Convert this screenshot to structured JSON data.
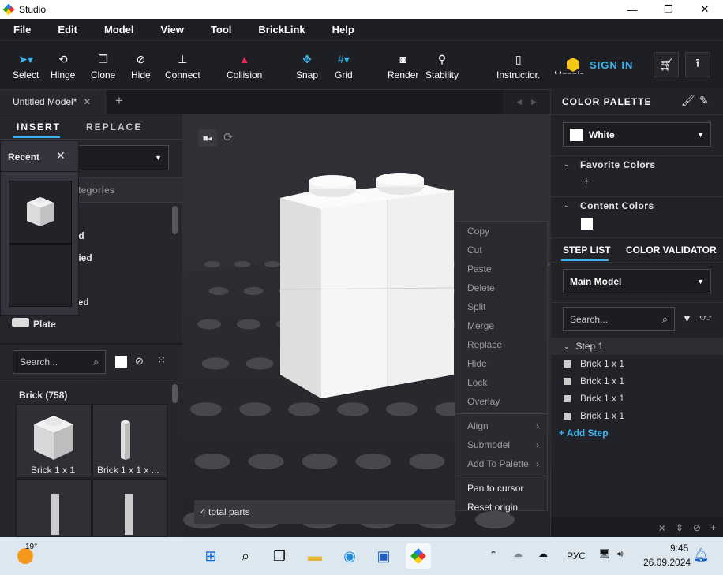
{
  "window": {
    "title": "Studio",
    "minimize": "—",
    "maximize": "❐",
    "close": "✕"
  },
  "menu": [
    "File",
    "Edit",
    "Model",
    "View",
    "Tool",
    "BrickLink",
    "Help"
  ],
  "toolbar": {
    "tools": [
      {
        "label": "Select",
        "icon": "cursor-icon"
      },
      {
        "label": "Hinge",
        "icon": "hinge-icon"
      },
      {
        "label": "Clone",
        "icon": "clone-icon"
      },
      {
        "label": "Hide",
        "icon": "hide-icon"
      },
      {
        "label": "Connect",
        "icon": "connect-icon"
      },
      {
        "label": "Collision",
        "icon": "collision-icon"
      },
      {
        "label": "Snap",
        "icon": "snap-icon"
      },
      {
        "label": "Grid",
        "icon": "grid-icon"
      },
      {
        "label": "Render",
        "icon": "render-icon"
      },
      {
        "label": "Stability",
        "icon": "stability-icon"
      },
      {
        "label": "Instructior.",
        "icon": "instructions-icon"
      },
      {
        "label": "Mosaic",
        "icon": "mosaic-icon"
      }
    ],
    "sign_in": "SIGN IN"
  },
  "tabs": {
    "active": "Untitled Model*",
    "add": "+"
  },
  "left": {
    "tabs": [
      "INSERT",
      "REPLACE"
    ],
    "recent_title": "Recent",
    "categories_label": "ategories",
    "partial_items": [
      "nd",
      "ified",
      "ved"
    ],
    "plate": "Plate",
    "search_placeholder": "Search...",
    "brick_header": "Brick (758)",
    "parts": [
      "Brick 1 x 1",
      "Brick 1 x 1 x ..."
    ]
  },
  "viewport": {
    "status": "4 total parts"
  },
  "context_menu": {
    "items": [
      {
        "label": "Copy",
        "enabled": false
      },
      {
        "label": "Cut",
        "enabled": false
      },
      {
        "label": "Paste",
        "enabled": false
      },
      {
        "label": "Delete",
        "enabled": false
      },
      {
        "label": "Split",
        "enabled": false
      },
      {
        "label": "Merge",
        "enabled": false
      },
      {
        "label": "Replace",
        "enabled": false
      },
      {
        "label": "Hide",
        "enabled": false
      },
      {
        "label": "Lock",
        "enabled": false
      },
      {
        "label": "Overlay",
        "enabled": false
      }
    ],
    "submenus": [
      "Align",
      "Submodel",
      "Add To Palette"
    ],
    "actions": [
      "Pan to cursor",
      "Reset origin"
    ]
  },
  "right": {
    "color_palette": "COLOR PALETTE",
    "selected_color": "White",
    "favorite_colors": "Favorite Colors",
    "content_colors": "Content Colors",
    "tabs": [
      "STEP LIST",
      "COLOR VALIDATOR"
    ],
    "model_select": "Main Model",
    "search_placeholder": "Search...",
    "step": "Step 1",
    "parts": [
      "Brick 1 x 1",
      "Brick 1 x 1",
      "Brick 1 x 1",
      "Brick 1 x 1"
    ],
    "add_step": "+ Add Step"
  },
  "taskbar": {
    "weather": "19°",
    "lang": "РУС",
    "time": "9:45",
    "date": "26.09.2024"
  },
  "colors": {
    "accent": "#3cb4f0",
    "collision": "#e8265a",
    "bg": "#1e1f24"
  }
}
